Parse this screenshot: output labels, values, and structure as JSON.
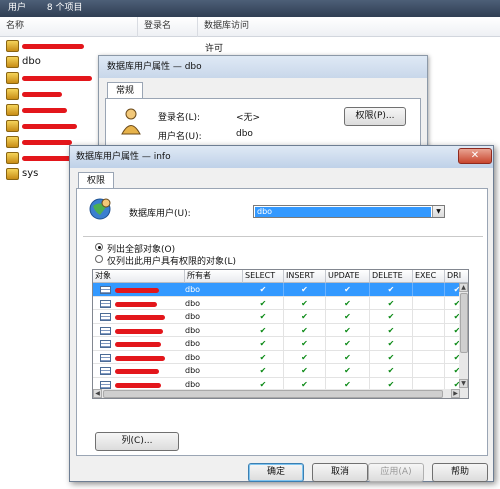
{
  "topbar": {
    "title": "用户",
    "count": "8 个项目"
  },
  "users_list": {
    "columns": [
      "名称",
      "登录名",
      "数据库访问"
    ],
    "first_permission": "许可",
    "rows": [
      {
        "name": ""
      },
      {
        "name": "dbo"
      },
      {
        "name": ""
      },
      {
        "name": ""
      },
      {
        "name": ""
      },
      {
        "name": ""
      },
      {
        "name": ""
      },
      {
        "name": ""
      },
      {
        "name": "sys"
      }
    ]
  },
  "dialog1": {
    "title": "数据库用户属性 — dbo",
    "tab": "常规",
    "login_label": "登录名(L):",
    "login_value": "<无>",
    "user_label": "用户名(U):",
    "user_value": "dbo",
    "perm_button": "权限(P)..."
  },
  "dialog2": {
    "title": "数据库用户属性 — info",
    "close": "✕",
    "tab": "权限",
    "db_user_label": "数据库用户(U):",
    "db_user_value": "dbo",
    "radio_all": "列出全部对象(O)",
    "radio_perm": "仅列出此用户具有权限的对象(L)",
    "columns": [
      "对象",
      "所有者",
      "SELECT",
      "INSERT",
      "UPDATE",
      "DELETE",
      "EXEC",
      "DRI"
    ],
    "rows": [
      {
        "owner": "dbo",
        "selected": true
      },
      {
        "owner": "dbo",
        "selected": false
      },
      {
        "owner": "dbo",
        "selected": false
      },
      {
        "owner": "dbo",
        "selected": false
      },
      {
        "owner": "dbo",
        "selected": false
      },
      {
        "owner": "dbo",
        "selected": false
      },
      {
        "owner": "dbo",
        "selected": false
      },
      {
        "owner": "dbo",
        "selected": false
      },
      {
        "owner": "",
        "selected": false
      }
    ],
    "check": "✔",
    "columns_button": "列(C)...",
    "ok": "确定",
    "cancel": "取消",
    "apply": "应用(A)",
    "help": "帮助"
  }
}
